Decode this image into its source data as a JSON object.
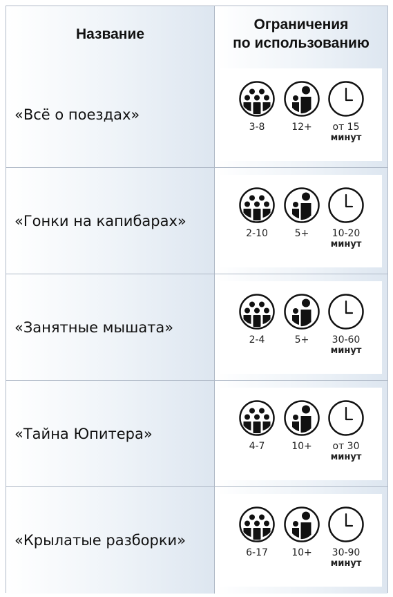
{
  "header": {
    "col_name": "Название",
    "col_limits_line1": "Ограничения",
    "col_limits_line2": "по использованию"
  },
  "rows": [
    {
      "name": "«Всё о поездах»",
      "players": "3-8",
      "age": "12+",
      "time": "от 15",
      "time_unit": "минут"
    },
    {
      "name": "«Гонки на капибарах»",
      "players": "2-10",
      "age": "5+",
      "time": "10-20",
      "time_unit": "минут"
    },
    {
      "name": "«Занятные мышата»",
      "players": "2-4",
      "age": "5+",
      "time": "30-60",
      "time_unit": "минут"
    },
    {
      "name": "«Тайна Юпитера»",
      "players": "4-7",
      "age": "10+",
      "time": "от 30",
      "time_unit": "минут"
    },
    {
      "name": "«Крылатые разборки»",
      "players": "6-17",
      "age": "10+",
      "time": "30-90",
      "time_unit": "минут"
    }
  ],
  "icons": {
    "players": "group-of-people-icon",
    "age": "adult-child-icon",
    "time": "clock-icon"
  }
}
